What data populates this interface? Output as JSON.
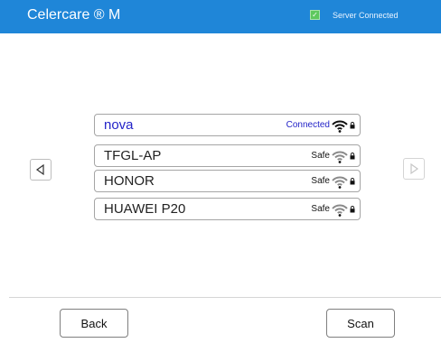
{
  "header": {
    "title": "Celercare ® M",
    "status_text": "Server Connected",
    "status_icon": "check-icon",
    "status_color": "#5dc85e",
    "bar_color": "#1f86d8"
  },
  "navigation": {
    "prev_icon": "left-arrow-icon",
    "next_icon": "right-arrow-icon"
  },
  "wifi_networks": [
    {
      "ssid": "nova",
      "status": "Connected",
      "icon": "wifi-icon",
      "lock_icon": "lock-icon"
    },
    {
      "ssid": "TFGL-AP",
      "status": "Safe",
      "icon": "wifi-icon",
      "lock_icon": "lock-icon"
    },
    {
      "ssid": "HONOR",
      "status": "Safe",
      "icon": "wifi-icon",
      "lock_icon": "lock-icon"
    },
    {
      "ssid": "HUAWEI P20",
      "status": "Safe",
      "icon": "wifi-icon",
      "lock_icon": "lock-icon"
    }
  ],
  "footer": {
    "back_label": "Back",
    "scan_label": "Scan"
  },
  "colors": {
    "connected_text": "#2323c8",
    "border": "#a5a5a5"
  }
}
